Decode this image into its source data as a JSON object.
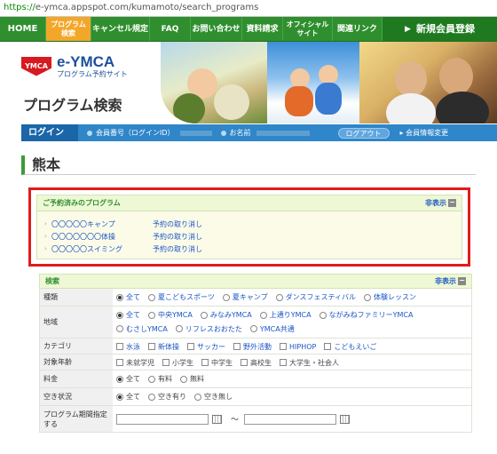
{
  "browser": {
    "url_scheme": "https://",
    "url_rest": "e-ymca.appspot.com/kumamoto/search_programs"
  },
  "nav": {
    "home": "HOME",
    "active_line1": "プログラム",
    "active_line2": "検索",
    "cancel_rules": "キャンセル規定",
    "faq": "FAQ",
    "contact": "お問い合わせ",
    "brochure": "資料請求",
    "official_line1": "オフィシャル",
    "official_line2": "サイト",
    "links": "関連リンク",
    "join": "新規会員登録"
  },
  "header": {
    "logo_mark": "YMCA",
    "logo_title": "e-YMCA",
    "logo_sub": "プログラム予約サイト",
    "page_title": "プログラム検索"
  },
  "loginbar": {
    "status": "ログイン中",
    "member_label": "会員番号（ログインID）",
    "name_label": "お名前",
    "logout": "ログアウト",
    "change_info": "会員情報変更"
  },
  "main": {
    "region": "熊本"
  },
  "reserved": {
    "title": "ご予約済みのプログラム",
    "hide": "非表示",
    "items": [
      {
        "name": "〇〇〇〇〇キャンプ",
        "cancel": "予約の取り消し"
      },
      {
        "name": "〇〇〇〇〇〇〇体操",
        "cancel": "予約の取り消し"
      },
      {
        "name": "〇〇〇〇〇スイミング",
        "cancel": "予約の取り消し"
      }
    ]
  },
  "search": {
    "title": "検索",
    "hide": "非表示",
    "category": {
      "label": "種類",
      "options": [
        "全て",
        "夏こどもスポーツ",
        "夏キャンプ",
        "ダンスフェスティバル",
        "体験レッスン"
      ]
    },
    "area": {
      "label": "地域",
      "options": [
        "全て",
        "中央YMCA",
        "みなみYMCA",
        "上通りYMCA",
        "ながみねファミリーYMCA",
        "むさしYMCA",
        "リフレスおおたた",
        "YMCA共通"
      ]
    },
    "genre": {
      "label": "カテゴリ",
      "options": [
        "水泳",
        "新体操",
        "サッカー",
        "野外活動",
        "HIPHOP",
        "こどもえいご"
      ]
    },
    "age": {
      "label": "対象年齢",
      "options": [
        "未就学児",
        "小学生",
        "中学生",
        "高校生",
        "大学生・社会人"
      ]
    },
    "fee": {
      "label": "料金",
      "options": [
        "全て",
        "有料",
        "無料"
      ]
    },
    "vacancy": {
      "label": "空き状況",
      "options": [
        "全て",
        "空き有り",
        "空き無し"
      ]
    },
    "period": {
      "label": "プログラム期間指定する",
      "separator": "〜"
    }
  }
}
